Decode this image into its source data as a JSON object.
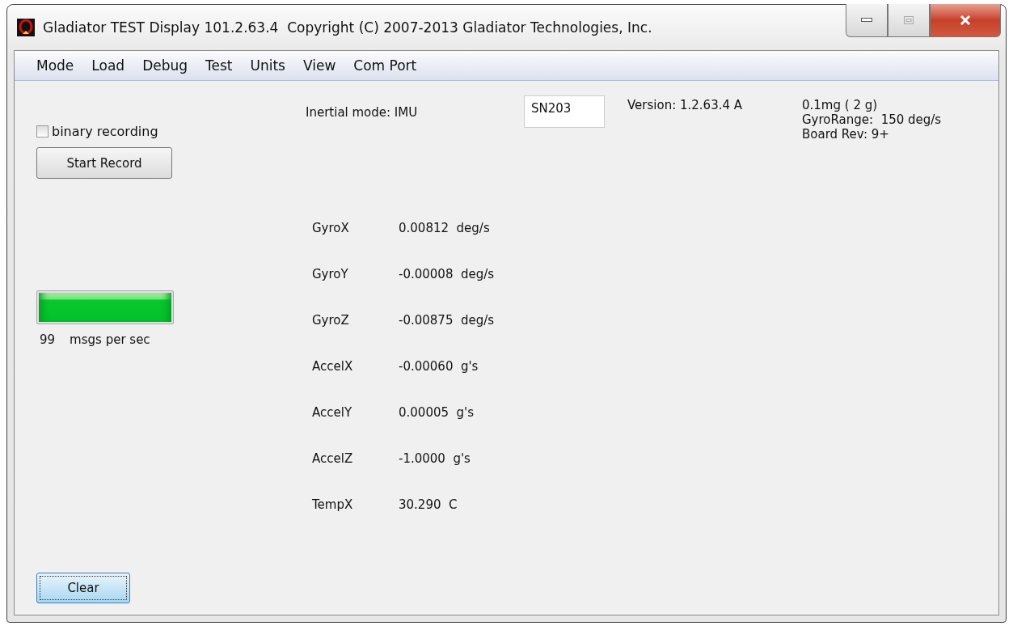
{
  "window": {
    "title": "Gladiator TEST Display 101.2.63.4  Copyright (C) 2007-2013 Gladiator Technologies, Inc."
  },
  "menu": [
    "Mode",
    "Load",
    "Debug",
    "Test",
    "Units",
    "View",
    "Com Port"
  ],
  "recording": {
    "label": "binary recording",
    "checked": false,
    "button": "Start Record"
  },
  "rate": {
    "level": 1,
    "count": "99",
    "unit": "msgs per sec"
  },
  "info": {
    "mode": "Inertial mode: IMU",
    "serial": "SN203",
    "version": "Version: 1.2.63.4 A",
    "details": [
      "0.1mg ( 2 g)",
      "GyroRange:  150 deg/s",
      "Board Rev: 9+"
    ]
  },
  "readings": [
    {
      "name": "GyroX",
      "value": "0.00812  deg/s"
    },
    {
      "name": "GyroY",
      "value": "-0.00008  deg/s"
    },
    {
      "name": "GyroZ",
      "value": "-0.00875  deg/s"
    },
    {
      "name": "AccelX",
      "value": "-0.00060  g's"
    },
    {
      "name": "AccelY",
      "value": "0.00005  g's"
    },
    {
      "name": "AccelZ",
      "value": "-1.0000  g's"
    },
    {
      "name": "TempX",
      "value": "30.290  C"
    }
  ],
  "clear_button": "Clear"
}
